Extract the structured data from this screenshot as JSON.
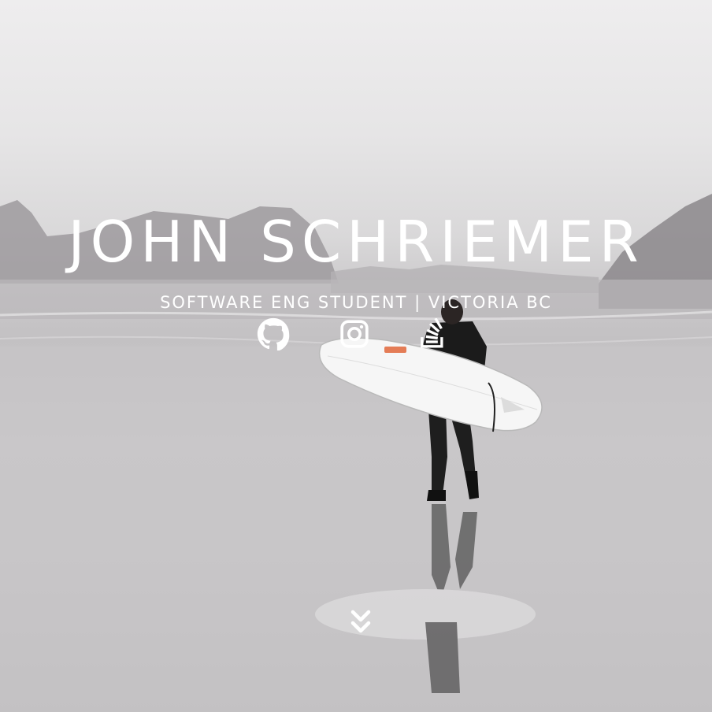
{
  "hero": {
    "name": "JOHN SCHRIEMER",
    "tagline": "SOFTWARE ENG STUDENT | VICTORIA BC"
  },
  "social_links": [
    {
      "icon": "github-icon"
    },
    {
      "icon": "instagram-icon"
    },
    {
      "icon": "stack-overflow-icon"
    }
  ],
  "scroll": {
    "icon": "double-chevron-down-icon"
  },
  "colors": {
    "text": "#ffffff",
    "sky": "#eeedee",
    "sand": "#c8c6c8"
  }
}
